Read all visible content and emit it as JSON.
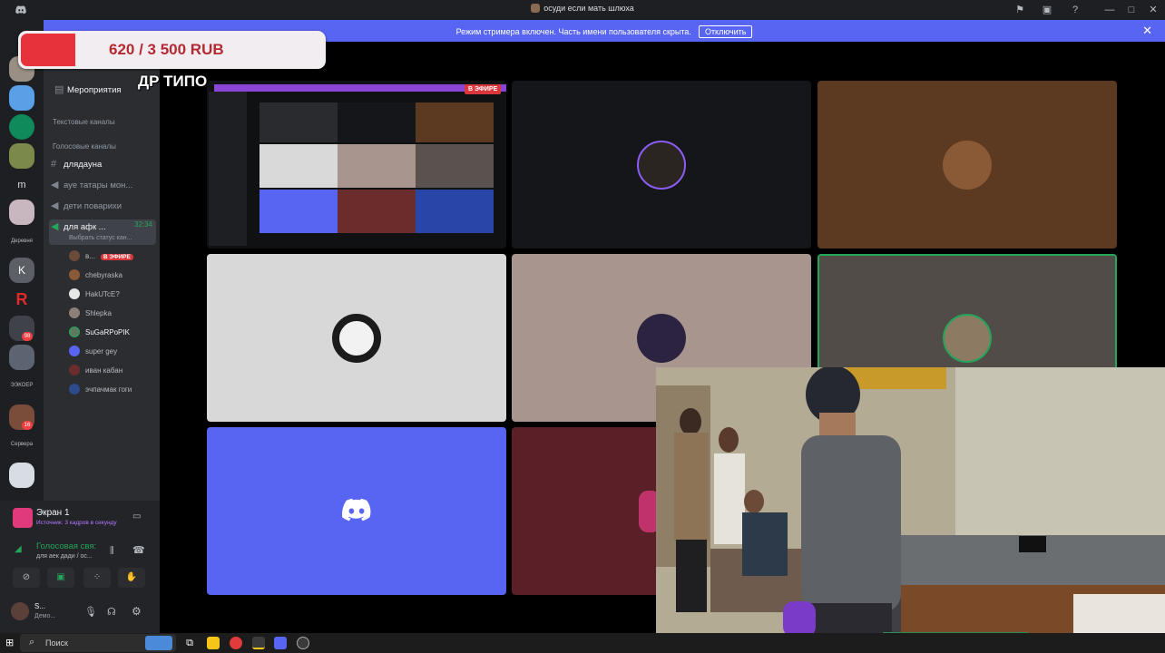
{
  "window": {
    "title": "осуди если мать шлюха"
  },
  "banner": {
    "message": "Режим стримера включен. Часть имени пользователя скрыта.",
    "disable_label": "Отключить",
    "close_glyph": "✕"
  },
  "donation": {
    "amount": "620 / 3 500 RUB",
    "progress_fraction": 0.18,
    "caption": "ДР ТИПО"
  },
  "servers": {
    "labels": [
      "Деревня",
      "ЭЭКОЕР",
      "Сервера"
    ],
    "badges": [
      "98",
      "16"
    ],
    "letters": [
      "m",
      "K",
      "R"
    ]
  },
  "channels": {
    "events_label": "Мероприятия",
    "text_category": "Текстовые каналы",
    "voice_category": "Голосовые каналы",
    "items": [
      {
        "name": "длядауна"
      },
      {
        "name": "ауе татары мон..."
      },
      {
        "name": "дети поварихи"
      },
      {
        "name": "для афк ...",
        "time": "32:34",
        "status": "Выбрать статус кан..."
      }
    ],
    "users": [
      {
        "name": "в...",
        "live": "В ЭФИРЕ"
      },
      {
        "name": "chebyraska"
      },
      {
        "name": "HakUTcE?"
      },
      {
        "name": "Shlepka"
      },
      {
        "name": "SuGaRPoPIK"
      },
      {
        "name": "super gey"
      },
      {
        "name": "иван кабан"
      },
      {
        "name": "эчпачмак гоги"
      }
    ]
  },
  "voice_panel": {
    "screen_title": "Экран 1",
    "screen_sub": "Источник: 3 кадров в секунду",
    "voice_status": "Голосовая свя:",
    "voice_channel": "для аек дади / ос...",
    "user_name": "S...",
    "user_status": "Демо..."
  },
  "taskbar": {
    "search_label": "Поиск"
  },
  "stream_preview": {
    "live_label": "В ЭФИРЕ"
  },
  "colors": {
    "discord_blurple": "#5865f2",
    "live_red": "#da373c",
    "speaking_green": "#23a55a"
  }
}
